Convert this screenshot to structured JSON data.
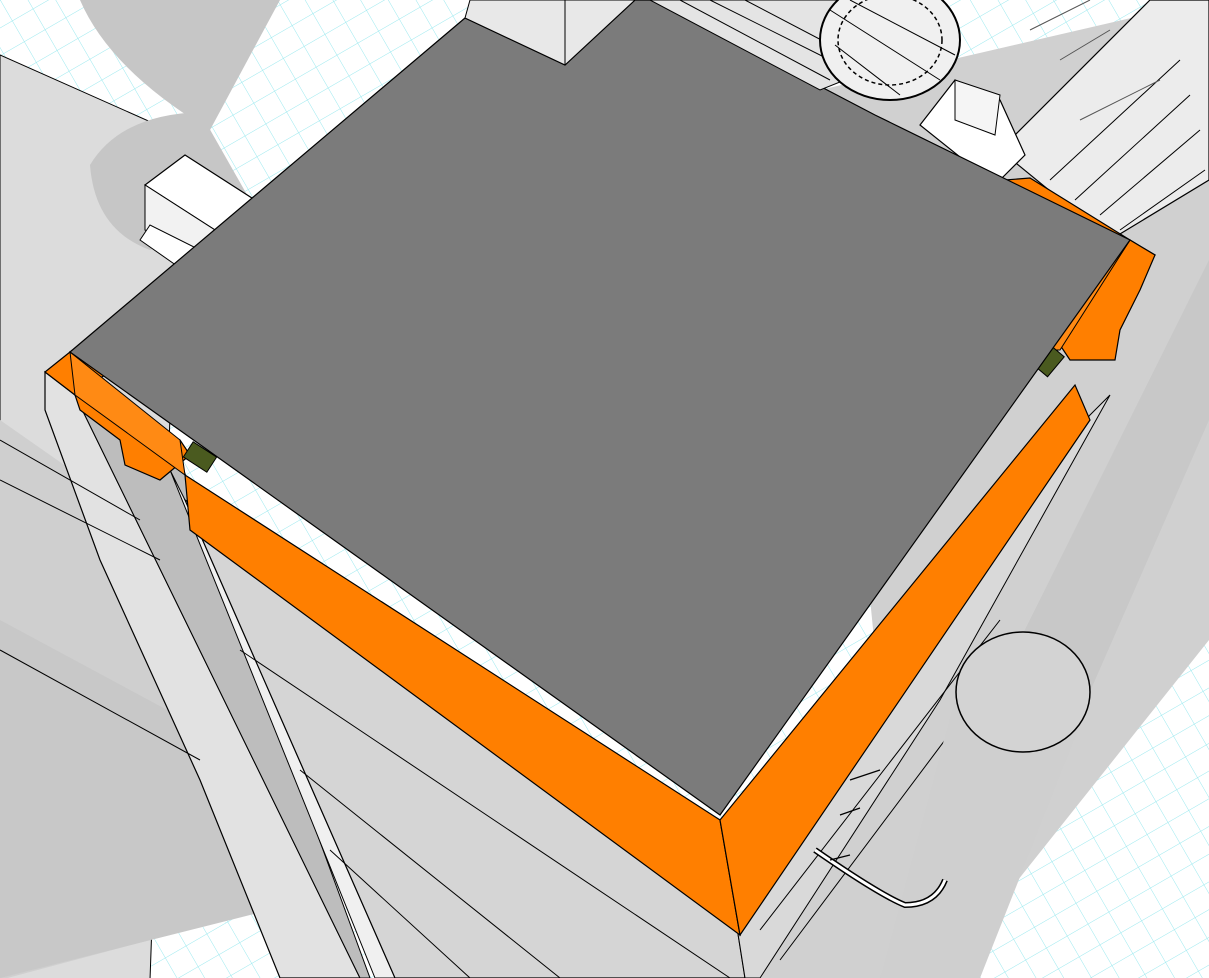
{
  "viewport": {
    "background": "#ffffff",
    "grid_color": "#7fe3ea"
  },
  "colors": {
    "roof": "#7b7b7b",
    "parapet": "#ff7f00",
    "wall_light": "#e6e6e6",
    "wall_mid": "#d3d3d3",
    "shadow": "#c6c6c6",
    "ground": "#d9d9d9",
    "highlight": "#ffffff",
    "drain": "#4a5a1f",
    "edge": "#000000"
  },
  "scene_objects": [
    {
      "name": "roof-slab"
    },
    {
      "name": "parapet-wall"
    },
    {
      "name": "tower-facade"
    },
    {
      "name": "roof-unit-west"
    },
    {
      "name": "roof-unit-east"
    },
    {
      "name": "roof-drain-west"
    },
    {
      "name": "roof-drain-east"
    },
    {
      "name": "cylindrical-column"
    },
    {
      "name": "neighbouring-building"
    },
    {
      "name": "railing-handrail"
    }
  ]
}
